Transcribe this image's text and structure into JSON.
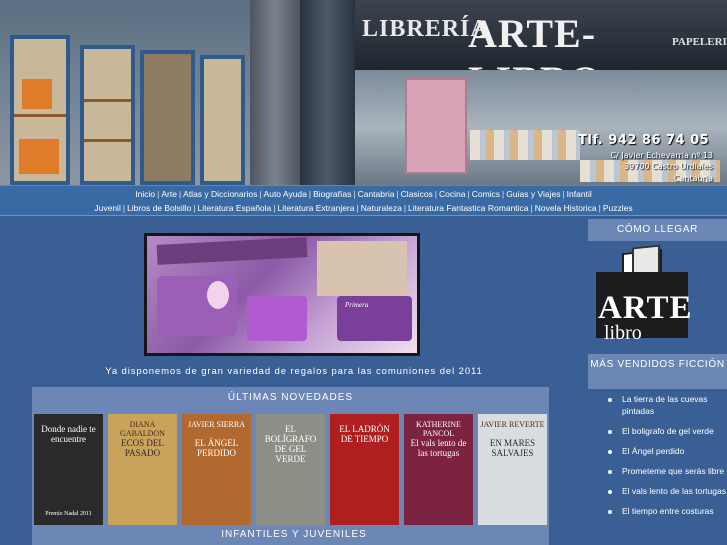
{
  "header": {
    "sign_libreria": "LIBRERÍA",
    "sign_arte_libro": "ARTE-LIBRO",
    "sign_papeleria": "PAPELERIA",
    "phone": "Tlf. 942 86 74 05",
    "address_line1": "C/ Javier Echevarria nº 13",
    "address_line2": "39700 Castro Urdiales",
    "address_line3": "Cantabria"
  },
  "nav": {
    "row1": [
      "Inicio",
      "Arte",
      "Atlas y Diccionarios",
      "Auto Ayuda",
      "Biografías",
      "Cantabria",
      "Clasicos",
      "Cocina",
      "Comics",
      "Guias y Viajes",
      "Infantil"
    ],
    "row2": [
      "Juvenil",
      "Libros de Bolsillo",
      "Literatura Española",
      "Literatura Extranjera",
      "Naturaleza",
      "Literatura Fantastica Romantica",
      "Novela Historica",
      "Puzzles"
    ]
  },
  "promo": {
    "caption": "Ya disponemos de gran variedad de regalos para las comuniones del 2011",
    "image_sign": "Primera"
  },
  "novedades": {
    "title": "ÚLTIMAS NOVEDADES",
    "books": [
      {
        "author": "",
        "title": "Donde nadie te encuentre",
        "badge": "Premio Nadal 2011",
        "bg": "#2a2a2a"
      },
      {
        "author": "DIANA GABALDON",
        "title": "ECOS DEL PASADO",
        "badge": "",
        "bg": "#c9a35c"
      },
      {
        "author": "JAVIER SIERRA",
        "title": "EL ÁNGEL PERDIDO",
        "badge": "",
        "bg": "#b2692f"
      },
      {
        "author": "",
        "title": "EL BOLÍGRAFO DE GEL VERDE",
        "badge": "",
        "bg": "#8d8f86"
      },
      {
        "author": "",
        "title": "EL LADRÓN DE TIEMPO",
        "badge": "",
        "bg": "#b01f1f"
      },
      {
        "author": "KATHERINE PANCOL",
        "title": "El vals lento de las tortugas",
        "badge": "",
        "bg": "#7b2340"
      },
      {
        "author": "JAVIER REVERTE",
        "title": "EN MARES SALVAJES",
        "badge": "",
        "bg": "#d9dde1"
      }
    ]
  },
  "infantiles": {
    "title": "INFANTILES Y JUVENILES"
  },
  "sidebar": {
    "como_llegar": "CÓMO LLEGAR",
    "logo_arte": "ARTE",
    "logo_libro": "libro",
    "mas_vendidos": "MÁS VENDIDOS FICCIÓN",
    "bestsellers": [
      "La tierra de las cuevas pintadas",
      "El boligrafo de gel verde",
      "El Ángel perdido",
      "Prometeme que serás libre",
      "El vals lento de las tortugas",
      "El tiempo entre costuras"
    ]
  },
  "colors": {
    "page_bg": "#3a5f95",
    "nav_bg": "#3a6aa3",
    "panel_bg": "#6c87b5"
  }
}
